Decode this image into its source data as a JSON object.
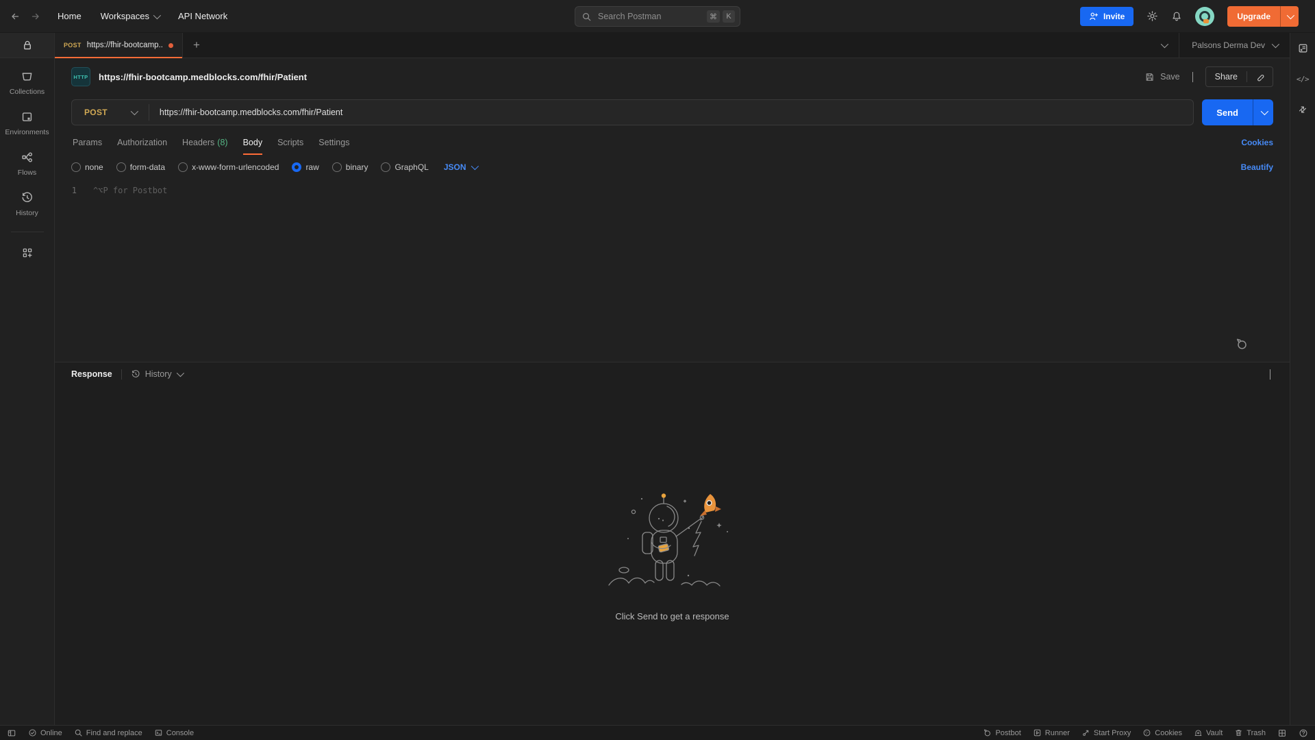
{
  "navbar": {
    "home": "Home",
    "workspaces": "Workspaces",
    "api_network": "API Network",
    "search_placeholder": "Search Postman",
    "shortcut_cmd": "⌘",
    "shortcut_k": "K",
    "invite": "Invite",
    "upgrade": "Upgrade"
  },
  "sidebar": {
    "items": [
      {
        "icon": "collections-icon",
        "label": "Collections"
      },
      {
        "icon": "environments-icon",
        "label": "Environments"
      },
      {
        "icon": "flows-icon",
        "label": "Flows"
      },
      {
        "icon": "history-icon",
        "label": "History"
      }
    ]
  },
  "tabbar": {
    "method": "POST",
    "title": "https://fhir-bootcamp..",
    "workspace": "Palsons Derma Dev"
  },
  "request": {
    "http_badge": "HTTP",
    "title": "https://fhir-bootcamp.medblocks.com/fhir/Patient",
    "save": "Save",
    "share": "Share",
    "method": "POST",
    "url": "https://fhir-bootcamp.medblocks.com/fhir/Patient",
    "send": "Send",
    "tabs": [
      {
        "label": "Params"
      },
      {
        "label": "Authorization"
      },
      {
        "label": "Headers",
        "count": "(8)"
      },
      {
        "label": "Body"
      },
      {
        "label": "Scripts"
      },
      {
        "label": "Settings"
      }
    ],
    "cookies": "Cookies",
    "beautify": "Beautify",
    "body_types": [
      {
        "label": "none"
      },
      {
        "label": "form-data"
      },
      {
        "label": "x-www-form-urlencoded"
      },
      {
        "label": "raw"
      },
      {
        "label": "binary"
      },
      {
        "label": "GraphQL"
      }
    ],
    "format": "JSON",
    "editor": {
      "line": "1",
      "placeholder": "^⌥P for Postbot"
    }
  },
  "response": {
    "label": "Response",
    "history": "History",
    "empty": "Click Send to get a response"
  },
  "statusbar": {
    "online": "Online",
    "find": "Find and replace",
    "console": "Console",
    "postbot": "Postbot",
    "runner": "Runner",
    "proxy": "Start Proxy",
    "cookies": "Cookies",
    "vault": "Vault",
    "trash": "Trash"
  },
  "icons": {
    "plus": "+",
    "code": "</>"
  },
  "colors": {
    "accent_orange": "#ff6c37",
    "upgrade_orange": "#f06b34",
    "accent_blue": "#1868f2",
    "link_blue": "#478bf7",
    "method_post_yellow": "#d1a954",
    "headers_count_green": "#55b685",
    "avatar_teal": "#85d7c3",
    "bg_dark": "#212121"
  }
}
